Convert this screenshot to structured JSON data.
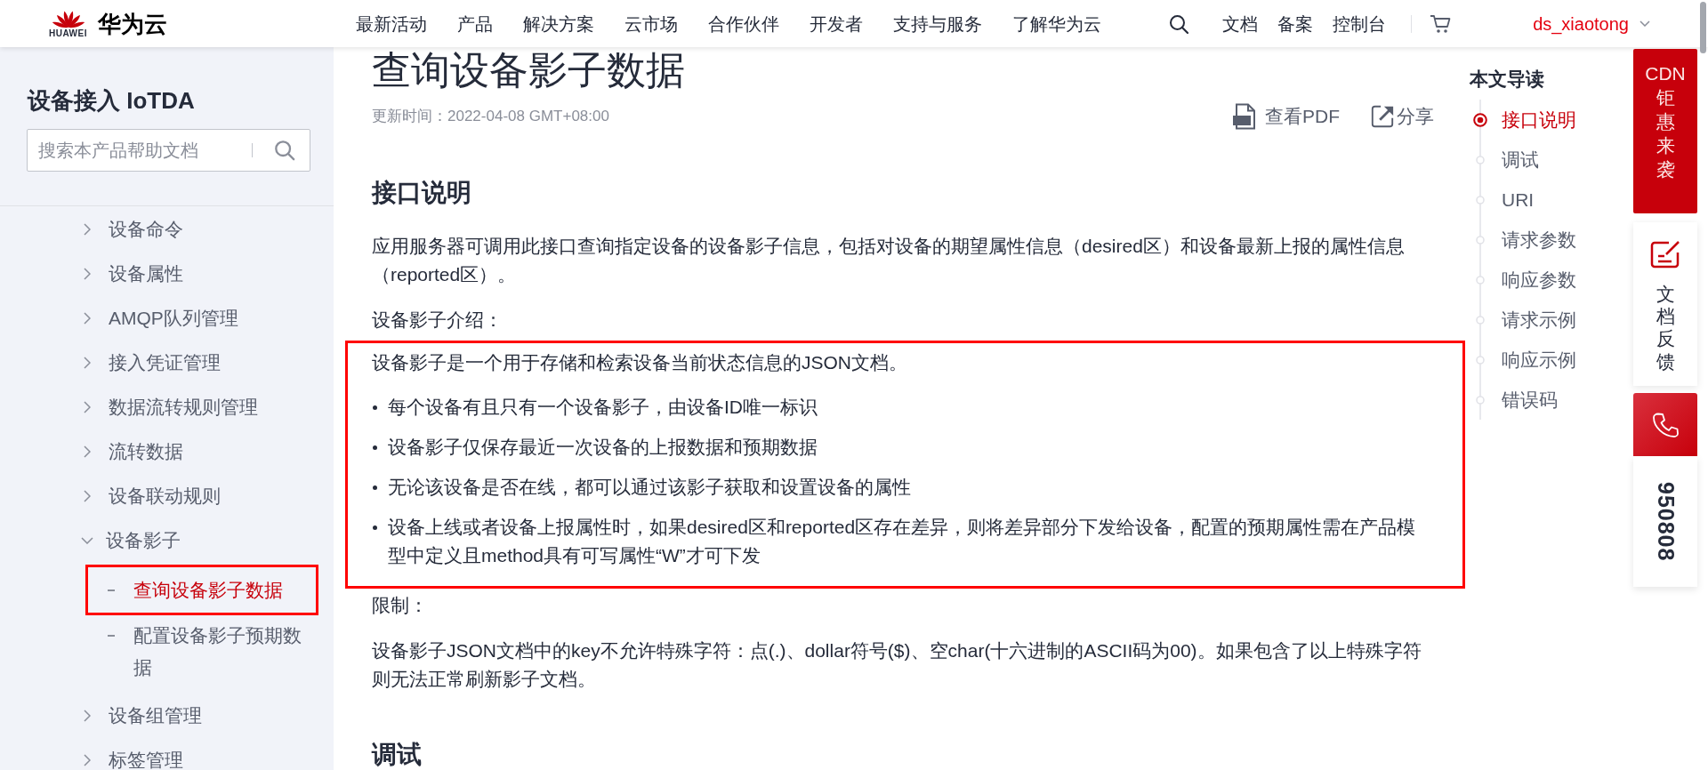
{
  "header": {
    "logo": {
      "brand": "HUAWEI",
      "name": "华为云"
    },
    "nav": [
      "最新活动",
      "产品",
      "解决方案",
      "云市场",
      "合作伙伴",
      "开发者",
      "支持与服务",
      "了解华为云"
    ],
    "links": [
      "文档",
      "备案",
      "控制台"
    ],
    "user": {
      "account": "ds_xiaotong"
    }
  },
  "sidebar": {
    "title": "设备接入 IoTDA",
    "search": {
      "placeholder": "搜索本产品帮助文档"
    },
    "items": [
      {
        "label": "设备命令",
        "expanded": false,
        "selected": false
      },
      {
        "label": "设备属性",
        "expanded": false,
        "selected": false
      },
      {
        "label": "AMQP队列管理",
        "expanded": false,
        "selected": false
      },
      {
        "label": "接入凭证管理",
        "expanded": false,
        "selected": false
      },
      {
        "label": "数据流转规则管理",
        "expanded": false,
        "selected": false
      },
      {
        "label": "流转数据",
        "expanded": false,
        "selected": false
      },
      {
        "label": "设备联动规则",
        "expanded": false,
        "selected": false
      },
      {
        "label": "设备影子",
        "expanded": true,
        "selected": false,
        "children": [
          {
            "label": "查询设备影子数据",
            "selected": true,
            "framed": true
          },
          {
            "label": "配置设备影子预期数据",
            "selected": false,
            "framed": false
          }
        ]
      },
      {
        "label": "设备组管理",
        "expanded": false,
        "selected": false
      },
      {
        "label": "标签管理",
        "expanded": false,
        "selected": false
      }
    ]
  },
  "article": {
    "title": "查询设备影子数据",
    "updated": "更新时间：2022-04-08 GMT+08:00",
    "actions": [
      {
        "kind": "pdf",
        "label": "查看PDF"
      },
      {
        "kind": "share",
        "label": "分享"
      }
    ],
    "blocks": [
      {
        "kind": "heading",
        "text": "接口说明"
      },
      {
        "kind": "paragraph",
        "text": "应用服务器可调用此接口查询指定设备的设备影子信息，包括对设备的期望属性信息（desired区）和设备最新上报的属性信息（reported区）。"
      },
      {
        "kind": "paragraph",
        "text": "设备影子介绍："
      },
      {
        "kind": "callout",
        "framed": true,
        "lead": "设备影子是一个用于存储和检索设备当前状态信息的JSON文档。",
        "items": [
          "每个设备有且只有一个设备影子，由设备ID唯一标识",
          "设备影子仅保存最近一次设备的上报数据和预期数据",
          "无论该设备是否在线，都可以通过该影子获取和设置设备的属性",
          "设备上线或者设备上报属性时，如果desired区和reported区存在差异，则将差异部分下发给设备，配置的预期属性需在产品模型中定义且method具有可写属性“W”才可下发"
        ]
      },
      {
        "kind": "paragraph",
        "text": "限制："
      },
      {
        "kind": "paragraph",
        "text": "设备影子JSON文档中的key不允许特殊字符：点(.)、dollar符号($)、空char(十六进制的ASCII码为00)。如果包含了以上特殊字符则无法正常刷新影子文档。"
      },
      {
        "kind": "heading",
        "text": "调试"
      }
    ]
  },
  "toc": {
    "title": "本文导读",
    "items": [
      {
        "label": "接口说明",
        "selected": true
      },
      {
        "label": "调试",
        "selected": false
      },
      {
        "label": "URI",
        "selected": false
      },
      {
        "label": "请求参数",
        "selected": false
      },
      {
        "label": "响应参数",
        "selected": false
      },
      {
        "label": "请求示例",
        "selected": false
      },
      {
        "label": "响应示例",
        "selected": false
      },
      {
        "label": "错误码",
        "selected": false
      }
    ]
  },
  "side_tools": [
    {
      "kind": "promo",
      "title": "CDN",
      "text": "钜惠来袭"
    },
    {
      "kind": "feedback",
      "text": "文档反馈"
    },
    {
      "kind": "phone"
    },
    {
      "kind": "hotline",
      "number": "950808"
    }
  ]
}
